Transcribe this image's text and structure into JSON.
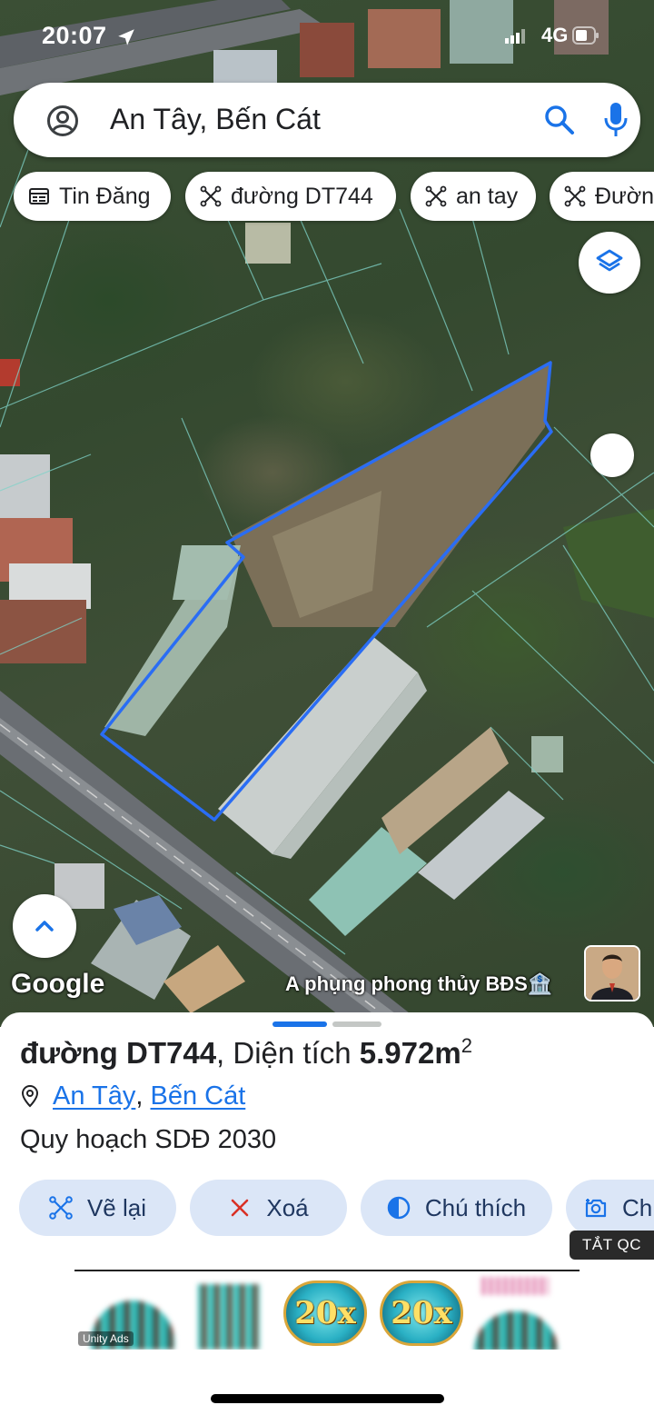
{
  "status_bar": {
    "time": "20:07",
    "network": "4G"
  },
  "search": {
    "query": "An Tây, Bến Cát"
  },
  "chips": [
    {
      "label": "Tin Đăng",
      "icon": "listing-icon"
    },
    {
      "label": "đường DT744",
      "icon": "polygon-icon"
    },
    {
      "label": "an tay",
      "icon": "polygon-icon"
    },
    {
      "label": "Đườn",
      "icon": "polygon-icon"
    }
  ],
  "map": {
    "logo": "Google",
    "attribution": "A phụng phong thủy BĐS🏦",
    "outline_color": "#2a6df4"
  },
  "sheet": {
    "title_name": "đường DT744",
    "title_sep": ", Diện tích ",
    "title_area": "5.972m",
    "title_sup": "2",
    "location_part1": "An Tây",
    "location_sep": ",",
    "location_part2": "Bến Cát",
    "plan": "Quy hoạch SDĐ 2030",
    "actions": [
      {
        "label": "Vẽ lại",
        "icon": "redraw-icon"
      },
      {
        "label": "Xoá",
        "icon": "close-icon"
      },
      {
        "label": "Chú thích",
        "icon": "contrast-icon"
      },
      {
        "label": "Ch",
        "icon": "camera-icon"
      }
    ],
    "ad_close_label": "TẮT QC"
  },
  "ad": {
    "brand": "Unity Ads",
    "badge_1": "20x",
    "badge_2": "20x"
  },
  "colors": {
    "accent": "#1a73e8",
    "chip_bg": "#ffffff",
    "action_bg": "#dbe6f7"
  }
}
